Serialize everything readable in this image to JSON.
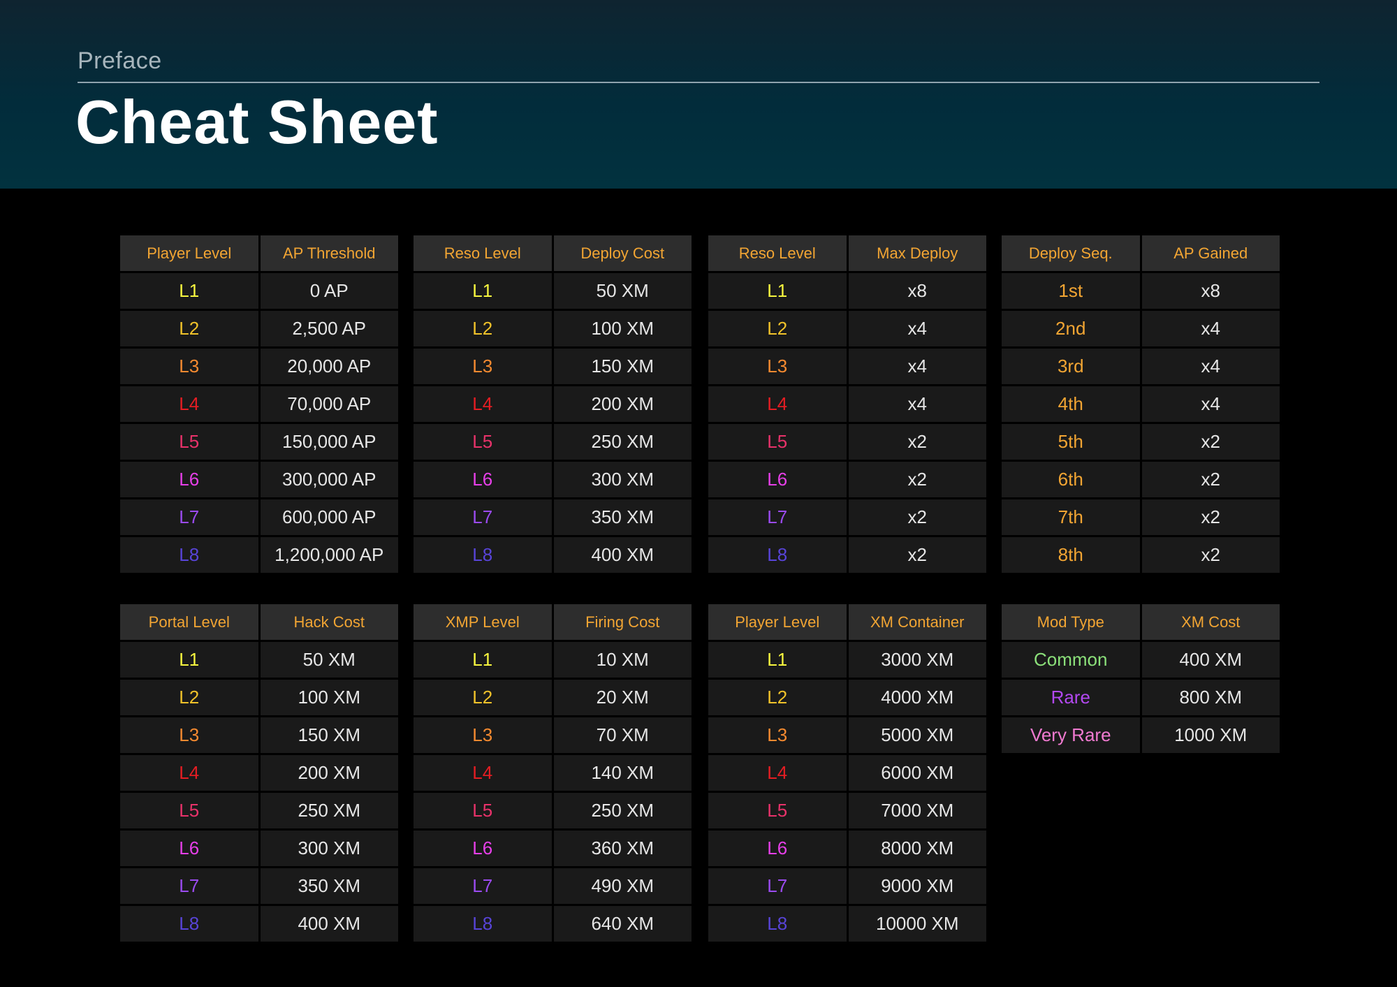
{
  "header": {
    "section": "Preface",
    "title": "Cheat Sheet"
  },
  "level_colors": {
    "L1": "#f6f53f",
    "L2": "#f0c22a",
    "L3": "#f58a30",
    "L4": "#e51d23",
    "L5": "#e8326a",
    "L6": "#e63fe8",
    "L7": "#9b4bf0",
    "L8": "#5844d8"
  },
  "accent_color": "#f2a533",
  "tables": [
    {
      "id": "player-ap",
      "headers": [
        "Player Level",
        "AP Threshold"
      ],
      "rows": [
        {
          "k": "L1",
          "v": "0 AP",
          "color": "#f6f53f"
        },
        {
          "k": "L2",
          "v": "2,500 AP",
          "color": "#f0c22a"
        },
        {
          "k": "L3",
          "v": "20,000 AP",
          "color": "#f58a30"
        },
        {
          "k": "L4",
          "v": "70,000 AP",
          "color": "#e51d23"
        },
        {
          "k": "L5",
          "v": "150,000 AP",
          "color": "#e8326a"
        },
        {
          "k": "L6",
          "v": "300,000 AP",
          "color": "#e63fe8"
        },
        {
          "k": "L7",
          "v": "600,000 AP",
          "color": "#9b4bf0"
        },
        {
          "k": "L8",
          "v": "1,200,000 AP",
          "color": "#5844d8"
        }
      ]
    },
    {
      "id": "reso-deploy-cost",
      "headers": [
        "Reso Level",
        "Deploy Cost"
      ],
      "rows": [
        {
          "k": "L1",
          "v": "50 XM",
          "color": "#f6f53f"
        },
        {
          "k": "L2",
          "v": "100 XM",
          "color": "#f0c22a"
        },
        {
          "k": "L3",
          "v": "150 XM",
          "color": "#f58a30"
        },
        {
          "k": "L4",
          "v": "200 XM",
          "color": "#e51d23"
        },
        {
          "k": "L5",
          "v": "250 XM",
          "color": "#e8326a"
        },
        {
          "k": "L6",
          "v": "300 XM",
          "color": "#e63fe8"
        },
        {
          "k": "L7",
          "v": "350 XM",
          "color": "#9b4bf0"
        },
        {
          "k": "L8",
          "v": "400 XM",
          "color": "#5844d8"
        }
      ]
    },
    {
      "id": "reso-max-deploy",
      "headers": [
        "Reso Level",
        "Max Deploy"
      ],
      "rows": [
        {
          "k": "L1",
          "v": "x8",
          "color": "#f6f53f"
        },
        {
          "k": "L2",
          "v": "x4",
          "color": "#f0c22a"
        },
        {
          "k": "L3",
          "v": "x4",
          "color": "#f58a30"
        },
        {
          "k": "L4",
          "v": "x4",
          "color": "#e51d23"
        },
        {
          "k": "L5",
          "v": "x2",
          "color": "#e8326a"
        },
        {
          "k": "L6",
          "v": "x2",
          "color": "#e63fe8"
        },
        {
          "k": "L7",
          "v": "x2",
          "color": "#9b4bf0"
        },
        {
          "k": "L8",
          "v": "x2",
          "color": "#5844d8"
        }
      ]
    },
    {
      "id": "deploy-seq-ap",
      "headers": [
        "Deploy Seq.",
        "AP Gained"
      ],
      "rows": [
        {
          "k": "1st",
          "v": "x8",
          "color": "#f2a533"
        },
        {
          "k": "2nd",
          "v": "x4",
          "color": "#f2a533"
        },
        {
          "k": "3rd",
          "v": "x4",
          "color": "#f2a533"
        },
        {
          "k": "4th",
          "v": "x4",
          "color": "#f2a533"
        },
        {
          "k": "5th",
          "v": "x2",
          "color": "#f2a533"
        },
        {
          "k": "6th",
          "v": "x2",
          "color": "#f2a533"
        },
        {
          "k": "7th",
          "v": "x2",
          "color": "#f2a533"
        },
        {
          "k": "8th",
          "v": "x2",
          "color": "#f2a533"
        }
      ]
    },
    {
      "id": "portal-hack-cost",
      "headers": [
        "Portal Level",
        "Hack Cost"
      ],
      "rows": [
        {
          "k": "L1",
          "v": "50 XM",
          "color": "#f6f53f"
        },
        {
          "k": "L2",
          "v": "100 XM",
          "color": "#f0c22a"
        },
        {
          "k": "L3",
          "v": "150 XM",
          "color": "#f58a30"
        },
        {
          "k": "L4",
          "v": "200 XM",
          "color": "#e51d23"
        },
        {
          "k": "L5",
          "v": "250 XM",
          "color": "#e8326a"
        },
        {
          "k": "L6",
          "v": "300 XM",
          "color": "#e63fe8"
        },
        {
          "k": "L7",
          "v": "350 XM",
          "color": "#9b4bf0"
        },
        {
          "k": "L8",
          "v": "400 XM",
          "color": "#5844d8"
        }
      ]
    },
    {
      "id": "xmp-firing-cost",
      "headers": [
        "XMP Level",
        "Firing Cost"
      ],
      "rows": [
        {
          "k": "L1",
          "v": "10 XM",
          "color": "#f6f53f"
        },
        {
          "k": "L2",
          "v": "20 XM",
          "color": "#f0c22a"
        },
        {
          "k": "L3",
          "v": "70 XM",
          "color": "#f58a30"
        },
        {
          "k": "L4",
          "v": "140 XM",
          "color": "#e51d23"
        },
        {
          "k": "L5",
          "v": "250 XM",
          "color": "#e8326a"
        },
        {
          "k": "L6",
          "v": "360 XM",
          "color": "#e63fe8"
        },
        {
          "k": "L7",
          "v": "490 XM",
          "color": "#9b4bf0"
        },
        {
          "k": "L8",
          "v": "640 XM",
          "color": "#5844d8"
        }
      ]
    },
    {
      "id": "player-xm-container",
      "headers": [
        "Player Level",
        "XM Container"
      ],
      "rows": [
        {
          "k": "L1",
          "v": "3000 XM",
          "color": "#f6f53f"
        },
        {
          "k": "L2",
          "v": "4000 XM",
          "color": "#f0c22a"
        },
        {
          "k": "L3",
          "v": "5000 XM",
          "color": "#f58a30"
        },
        {
          "k": "L4",
          "v": "6000 XM",
          "color": "#e51d23"
        },
        {
          "k": "L5",
          "v": "7000 XM",
          "color": "#e8326a"
        },
        {
          "k": "L6",
          "v": "8000 XM",
          "color": "#e63fe8"
        },
        {
          "k": "L7",
          "v": "9000 XM",
          "color": "#9b4bf0"
        },
        {
          "k": "L8",
          "v": "10000 XM",
          "color": "#5844d8"
        }
      ]
    },
    {
      "id": "mod-xm-cost",
      "headers": [
        "Mod Type",
        "XM Cost"
      ],
      "rows": [
        {
          "k": "Common",
          "v": "400 XM",
          "color": "#8be07a"
        },
        {
          "k": "Rare",
          "v": "800 XM",
          "color": "#b248f0"
        },
        {
          "k": "Very Rare",
          "v": "1000 XM",
          "color": "#f07ad0"
        }
      ]
    }
  ]
}
